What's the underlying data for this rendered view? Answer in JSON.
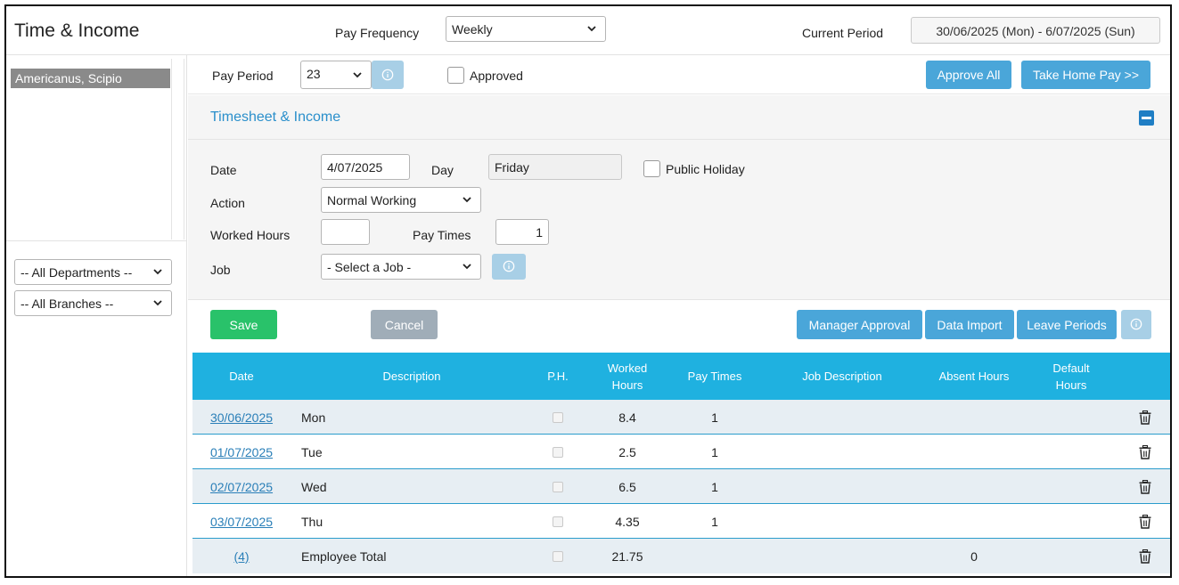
{
  "header": {
    "title": "Time & Income",
    "pay_frequency_label": "Pay Frequency",
    "pay_frequency_value": "Weekly",
    "current_period_label": "Current Period",
    "current_period_value": "30/06/2025 (Mon) - 6/07/2025 (Sun)"
  },
  "sidebar": {
    "employees": [
      "Americanus, Scipio"
    ],
    "department_filter": "-- All Departments --",
    "branch_filter": "-- All Branches --"
  },
  "pay_period": {
    "label": "Pay Period",
    "value": "23",
    "approved_label": "Approved",
    "approve_all_button": "Approve All",
    "take_home_pay_button": "Take Home Pay >>"
  },
  "section": {
    "title": "Timesheet & Income"
  },
  "form": {
    "date_label": "Date",
    "date_value": "4/07/2025",
    "day_label": "Day",
    "day_value": "Friday",
    "public_holiday_label": "Public Holiday",
    "action_label": "Action",
    "action_value": "Normal Working",
    "worked_hours_label": "Worked Hours",
    "worked_hours_value": "",
    "pay_times_label": "Pay Times",
    "pay_times_value": "1",
    "job_label": "Job",
    "job_value": "- Select a Job -"
  },
  "actions": {
    "save": "Save",
    "cancel": "Cancel",
    "manager_approval": "Manager Approval",
    "data_import": "Data Import",
    "leave_periods": "Leave Periods"
  },
  "table": {
    "headers": {
      "date": "Date",
      "description": "Description",
      "ph": "P.H.",
      "worked_hours_1": "Worked",
      "worked_hours_2": "Hours",
      "pay_times": "Pay Times",
      "job_description": "Job Description",
      "absent_hours": "Absent Hours",
      "default_hours_1": "Default",
      "default_hours_2": "Hours"
    },
    "rows": [
      {
        "date": "30/06/2025",
        "description": "Mon",
        "worked_hours": "8.4",
        "pay_times": "1",
        "job_description": "",
        "absent_hours": "",
        "default_hours": ""
      },
      {
        "date": "01/07/2025",
        "description": "Tue",
        "worked_hours": "2.5",
        "pay_times": "1",
        "job_description": "",
        "absent_hours": "",
        "default_hours": ""
      },
      {
        "date": "02/07/2025",
        "description": "Wed",
        "worked_hours": "6.5",
        "pay_times": "1",
        "job_description": "",
        "absent_hours": "",
        "default_hours": ""
      },
      {
        "date": "03/07/2025",
        "description": "Thu",
        "worked_hours": "4.35",
        "pay_times": "1",
        "job_description": "",
        "absent_hours": "",
        "default_hours": ""
      },
      {
        "date": "(4)",
        "description": "Employee Total",
        "worked_hours": "21.75",
        "pay_times": "",
        "job_description": "",
        "absent_hours": "0",
        "default_hours": ""
      }
    ]
  },
  "colors": {
    "accent_blue": "#4aa6d9",
    "table_header": "#1fb1e0",
    "save_green": "#29c26a",
    "link": "#2a7fb8"
  }
}
